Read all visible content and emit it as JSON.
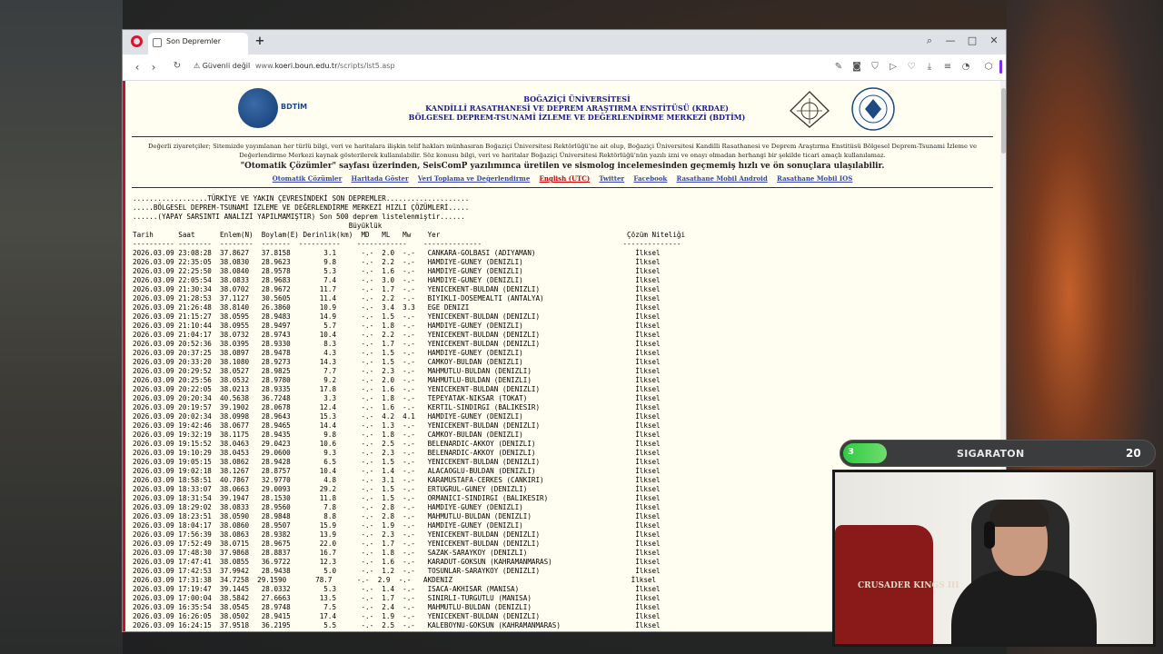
{
  "browser": {
    "tab_title": "Son Depremler",
    "new_tab": "+",
    "security": "Güvenli değil",
    "url_prefix": "www.",
    "url_domain": "koeri.boun.edu.tr",
    "url_path": "/scripts/lst5.asp"
  },
  "header": {
    "logo_text": "BDTİM",
    "line1": "BOĞAZİÇİ ÜNİVERSİTESİ",
    "line2": "KANDİLLİ RASATHANESİ VE DEPREM ARAŞTIRMA ENSTİTÜSÜ (KRDAE)",
    "line3": "BÖLGESEL DEPREM-TSUNAMİ İZLEME VE DEĞERLENDİRME MERKEZİ (BDTİM)",
    "seal_text": "BOĞAZİÇİ ÜNİVERSİTESİ 1863"
  },
  "notice": "Değerli ziyaretçiler; Sitemizde yayımlanan her türlü bilgi, veri ve haritalara ilişkin telif hakları münhasıran Boğaziçi Üniversitesi Rektörlüğü'ne ait olup, Boğaziçi Üniversitesi Kandilli Rasathanesi ve Deprem Araştırma Enstitüsü Bölgesel Deprem-Tsunami İzleme ve Değerlendirme Merkezi kaynak gösterilerek kullanılabilir. Söz konusu bilgi, veri ve haritalar Boğaziçi Üniversitesi Rektörlüğü'nün yazılı izni ve onayı olmadan herhangi bir şekilde ticari amaçlı kullanılamaz.",
  "note2": "\"Otomatik Çözümler\" sayfası üzerinden, SeisComP yazılımınca üretilen ve sismolog incelemesinden geçmemiş hızlı ve ön sonuçlara ulaşılabilir.",
  "links": [
    "Otomatik Çözümler",
    "Haritada Göster",
    "Veri Toplama ve Değerlendirme",
    "English (UTC)",
    "Twitter",
    "Facebook",
    "Rasathane Mobil Android",
    "Rasathane Mobil IOS"
  ],
  "table_header": [
    "..................TÜRKİYE VE YAKIN ÇEVRESİNDEKİ SON DEPREMLER....................",
    ".....BÖLGESEL DEPREM-TSUNAMİ İZLEME VE DEĞERLENDİRME MERKEZİ HIZLI ÇÖZÜMLERİ.....",
    "......(YAPAY SARSINTI ANALİZİ YAPILMAMIŞTIR) Son 500 deprem listelenmiştir......",
    "                                                    Büyüklük",
    "Tarih      Saat      Enlem(N)  Boylam(E) Derinlik(km)  MD   ML   Mw    Yer                                             Çözüm Niteliği",
    "---------- --------  --------  -------  ----------    ------------    --------------                                  --------------"
  ],
  "rows": [
    "2026.03.09 23:08:28  37.8627   37.8158        3.1      -.-  2.0  -.-   CANKARA-GOLBASI (ADIYAMAN)                        İlksel",
    "2026.03.09 22:35:05  38.0830   28.9623        9.8      -.-  2.2  -.-   HAMDIYE-GUNEY (DENIZLI)                           İlksel",
    "2026.03.09 22:25:50  38.0840   28.9578        5.3      -.-  1.6  -.-   HAMDIYE-GUNEY (DENIZLI)                           İlksel",
    "2026.03.09 22:05:54  38.0833   28.9683        7.4      -.-  3.0  -.-   HAMDIYE-GUNEY (DENIZLI)                           İlksel",
    "2026.03.09 21:30:34  38.0702   28.9672       11.7      -.-  1.7  -.-   YENICEKENT-BULDAN (DENIZLI)                       İlksel",
    "2026.03.09 21:28:53  37.1127   30.5605       11.4      -.-  2.2  -.-   BIYIKLI-DOSEMEALTI (ANTALYA)                      İlksel",
    "2026.03.09 21:26:48  38.8140   26.3860       10.9      -.-  3.4  3.3   EGE DENIZI                                        İlksel",
    "2026.03.09 21:15:27  38.0595   28.9483       14.9      -.-  1.5  -.-   YENICEKENT-BULDAN (DENIZLI)                       İlksel",
    "2026.03.09 21:10:44  38.0955   28.9497        5.7      -.-  1.8  -.-   HAMDIYE-GUNEY (DENIZLI)                           İlksel",
    "2026.03.09 21:04:17  38.0732   28.9743       10.4      -.-  2.2  -.-   YENICEKENT-BULDAN (DENIZLI)                       İlksel",
    "2026.03.09 20:52:36  38.0395   28.9330        8.3      -.-  1.7  -.-   YENICEKENT-BULDAN (DENIZLI)                       İlksel",
    "2026.03.09 20:37:25  38.0897   28.9478        4.3      -.-  1.5  -.-   HAMDIYE-GUNEY (DENIZLI)                           İlksel",
    "2026.03.09 20:33:20  38.1080   28.9273       14.3      -.-  1.5  -.-   CAMKOY-BULDAN (DENIZLI)                           İlksel",
    "2026.03.09 20:29:52  38.0527   28.9825        7.7      -.-  2.3  -.-   MAHMUTLU-BULDAN (DENIZLI)                         İlksel",
    "2026.03.09 20:25:56  38.0532   28.9780        9.2      -.-  2.0  -.-   MAHMUTLU-BULDAN (DENIZLI)                         İlksel",
    "2026.03.09 20:22:05  38.0213   28.9335       17.8      -.-  1.6  -.-   YENICEKENT-BULDAN (DENIZLI)                       İlksel",
    "2026.03.09 20:20:34  40.5638   36.7248        3.3      -.-  1.8  -.-   TEPEYATAK-NIKSAR (TOKAT)                          İlksel",
    "2026.03.09 20:19:57  39.1902   28.0678       12.4      -.-  1.6  -.-   KERTIL-SINDIRGI (BALIKESIR)                       İlksel",
    "2026.03.09 20:02:34  38.0998   28.9643       15.3      -.-  4.2  4.1   HAMDIYE-GUNEY (DENIZLI)                           İlksel",
    "2026.03.09 19:42:46  38.0677   28.9465       14.4      -.-  1.3  -.-   YENICEKENT-BULDAN (DENIZLI)                       İlksel",
    "2026.03.09 19:32:19  38.1175   28.9435        9.8      -.-  1.8  -.-   CAMKOY-BULDAN (DENIZLI)                           İlksel",
    "2026.03.09 19:15:52  38.0463   29.0423       10.6      -.-  2.5  -.-   BELENARDIC-AKKOY (DENIZLI)                        İlksel",
    "2026.03.09 19:10:29  38.0453   29.0600        9.3      -.-  2.3  -.-   BELENARDIC-AKKOY (DENIZLI)                        İlksel",
    "2026.03.09 19:05:15  38.0862   28.9428        6.5      -.-  1.5  -.-   YENICEKENT-BULDAN (DENIZLI)                       İlksel",
    "2026.03.09 19:02:18  38.1267   28.8757       10.4      -.-  1.4  -.-   ALACAOGLU-BULDAN (DENIZLI)                        İlksel",
    "2026.03.09 18:58:51  40.7867   32.9770        4.8      -.-  3.1  -.-   KARAMUSTAFA-CERKES (CANKIRI)                      İlksel",
    "2026.03.09 18:33:07  38.0663   29.0093       29.2      -.-  1.5  -.-   ERTUGRUL-GUNEY (DENIZLI)                          İlksel",
    "2026.03.09 18:31:54  39.1947   28.1530       11.8      -.-  1.5  -.-   ORMANICI-SINDIRGI (BALIKESIR)                     İlksel",
    "2026.03.09 18:29:02  38.0833   28.9560        7.8      -.-  2.8  -.-   HAMDIYE-GUNEY (DENIZLI)                           İlksel",
    "2026.03.09 18:23:51  38.0590   28.9848        8.8      -.-  2.8  -.-   MAHMUTLU-BULDAN (DENIZLI)                         İlksel",
    "2026.03.09 18:04:17  38.0860   28.9507       15.9      -.-  1.9  -.-   HAMDIYE-GUNEY (DENIZLI)                           İlksel",
    "2026.03.09 17:56:39  38.0863   28.9382       13.9      -.-  2.3  -.-   YENICEKENT-BULDAN (DENIZLI)                       İlksel",
    "2026.03.09 17:52:49  38.0715   28.9675       22.0      -.-  1.7  -.-   YENICEKENT-BULDAN (DENIZLI)                       İlksel",
    "2026.03.09 17:48:30  37.9868   28.8837       16.7      -.-  1.8  -.-   SAZAK-SARAYKOY (DENIZLI)                          İlksel",
    "2026.03.09 17:47:41  38.0855   36.9722       12.3      -.-  1.6  -.-   KARADUT-GOKSUN (KAHRAMANMARAS)                    İlksel",
    "2026.03.09 17:42:53  37.9942   28.9438        5.0      -.-  1.2  -.-   TOSUNLAR-SARAYKOY (DENIZLI)                       İlksel",
    "2026.03.09 17:31:38  34.7258  29.1590       78.7      -.-  2.9  -.-   AKDENIZ                                           İlksel",
    "2026.03.09 17:19:47  39.1445   28.0332        5.3      -.-  1.4  -.-   ISACA-AKHISAR (MANISA)                            İlksel",
    "2026.03.09 17:00:04  38.5842   27.6663       13.5      -.-  1.7  -.-   SINIRLI-TURGUTLU (MANISA)                         İlksel",
    "2026.03.09 16:35:54  38.0545   28.9748        7.5      -.-  2.4  -.-   MAHMUTLU-BULDAN (DENIZLI)                         İlksel",
    "2026.03.09 16:26:05  38.0502   28.9415       17.4      -.-  1.9  -.-   YENICEKENT-BULDAN (DENIZLI)                       İlksel",
    "2026.03.09 16:24:15  37.9518   36.2195        5.5      -.-  2.5  -.-   KALEBOYNU-GOKSUN (KAHRAMANMARAS)                  İlksel"
  ],
  "overlay": {
    "count_left": "3",
    "label": "SIGARATON",
    "count_right": "20"
  },
  "webcam": {
    "chair_text": "CRUSADER KINGS III"
  }
}
